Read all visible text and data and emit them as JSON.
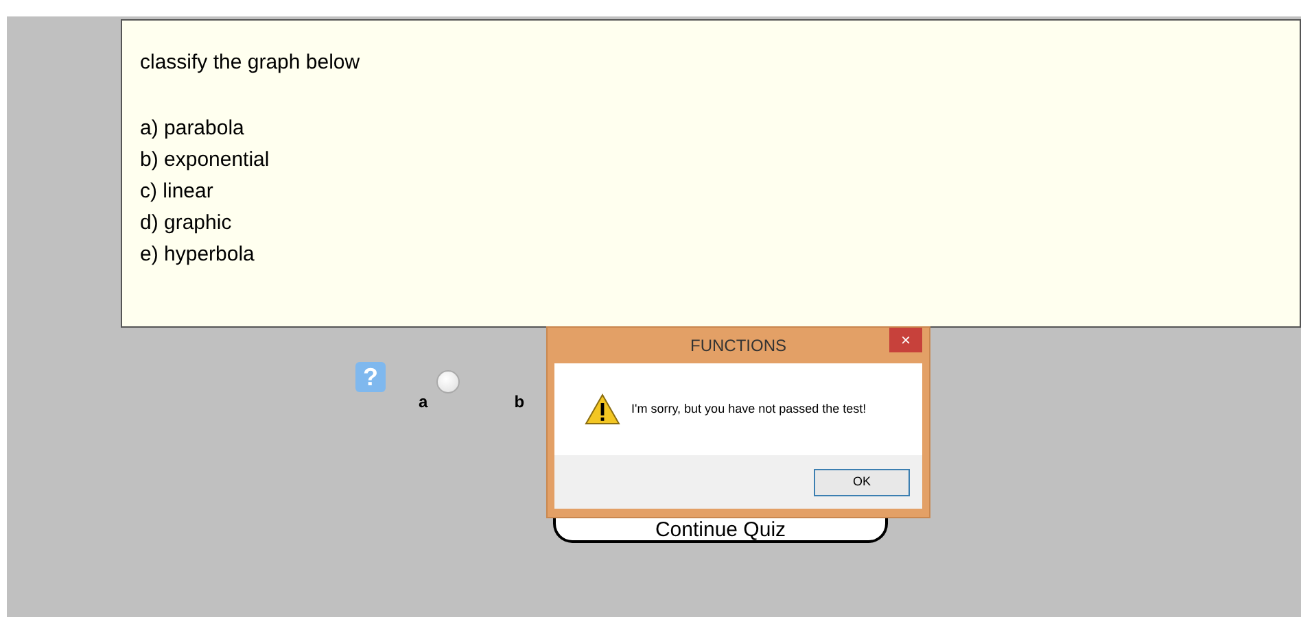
{
  "question": {
    "prompt": "classify the graph below",
    "choices": [
      "a) parabola",
      "b) exponential",
      "c) linear",
      "d) graphic",
      "e) hyperbola"
    ]
  },
  "radio_options": [
    {
      "label": "a",
      "selected": false
    },
    {
      "label": "b"
    }
  ],
  "help_button": "?",
  "continue_button": "Continue Quiz",
  "dialog": {
    "title": "FUNCTIONS",
    "close": "×",
    "message": "I'm sorry, but you have not passed the test!",
    "ok": "OK"
  }
}
